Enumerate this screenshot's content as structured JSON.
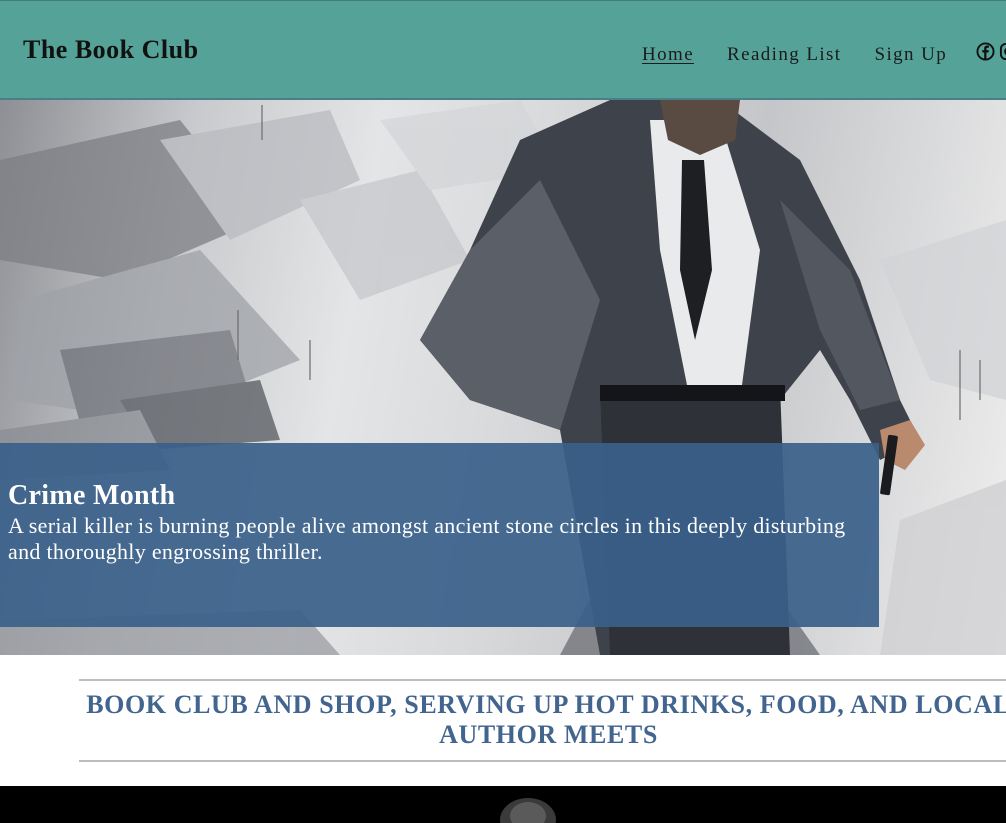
{
  "header": {
    "brand": "The Book Club",
    "nav": [
      "Home",
      "Reading List",
      "Sign Up"
    ],
    "social_icons": [
      "facebook-icon",
      "instagram-icon"
    ]
  },
  "hero": {
    "title": "Crime Month",
    "text": "A serial killer is burning people alive amongst ancient stone circles in this deeply disturbing and thoroughly engrossing thriller."
  },
  "intro": {
    "text": "BOOK CLUB AND SHOP, SERVING UP HOT DRINKS, FOOD, AND LOCAL AUTHOR MEETS"
  },
  "colors": {
    "header_bg": "#55a398",
    "card_bg": "#3a5f8a",
    "intro_text": "#42658f"
  }
}
